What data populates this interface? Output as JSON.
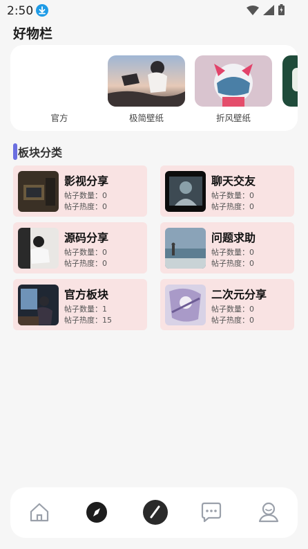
{
  "status": {
    "time": "2:50"
  },
  "header": {
    "title": "好物栏"
  },
  "shelf": {
    "items": [
      {
        "label": "官方"
      },
      {
        "label": "极简壁纸"
      },
      {
        "label": "折风壁纸"
      }
    ]
  },
  "categories": {
    "title": "板块分类",
    "cards": [
      {
        "name": "影视分享",
        "posts": "帖子数量：0",
        "heat": "帖子热度：0"
      },
      {
        "name": "聊天交友",
        "posts": "帖子数量：0",
        "heat": "帖子热度：0"
      },
      {
        "name": "源码分享",
        "posts": "帖子数量：0",
        "heat": "帖子热度：0"
      },
      {
        "name": "问题求助",
        "posts": "帖子数量：0",
        "heat": "帖子热度：0"
      },
      {
        "name": "官方板块",
        "posts": "帖子数量：1",
        "heat": "帖子热度：15"
      },
      {
        "name": "二次元分享",
        "posts": "帖子数量：0",
        "heat": "帖子热度：0"
      }
    ]
  },
  "nav": {
    "items": [
      {
        "icon": "home-icon"
      },
      {
        "icon": "compass-icon"
      },
      {
        "icon": "pencil-icon"
      },
      {
        "icon": "chat-icon"
      },
      {
        "icon": "profile-icon"
      }
    ]
  },
  "colors": {
    "accent": "#6b6fe0",
    "card_bg": "#f9e3e3"
  }
}
